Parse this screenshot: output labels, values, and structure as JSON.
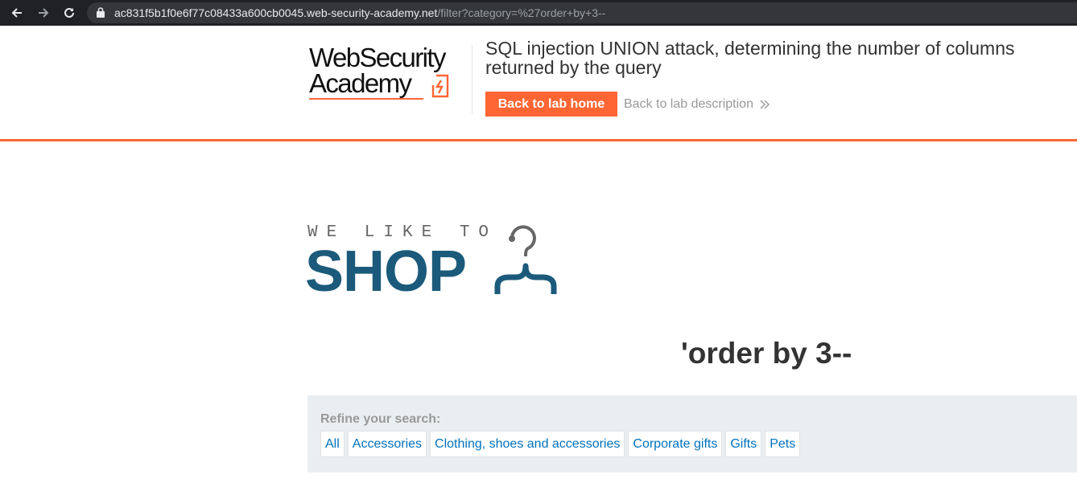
{
  "browser": {
    "url_host": "ac831f5b1f0e6f77c08433a600cb0045.web-security-academy.net",
    "url_path": "/filter?category=%27order+by+3--"
  },
  "academy_header": {
    "logo_line1": "WebSecurity",
    "logo_line2": "Academy",
    "lab_title": "SQL injection UNION attack, determining the number of columns returned by the query",
    "back_home_label": "Back to lab home",
    "back_desc_label": "Back to lab description"
  },
  "shop_logo": {
    "small_text": "WE LIKE TO",
    "big_text": "SHOP"
  },
  "search": {
    "heading": "'order by 3--"
  },
  "filters": {
    "label": "Refine your search:",
    "items": [
      "All",
      "Accessories",
      "Clothing, shoes and accessories",
      "Corporate gifts",
      "Gifts",
      "Pets"
    ]
  },
  "colors": {
    "accent": "#ff6633",
    "shop_blue": "#1b5a7a",
    "link_blue": "#0071bc",
    "panel_bg": "#ebeef0"
  }
}
